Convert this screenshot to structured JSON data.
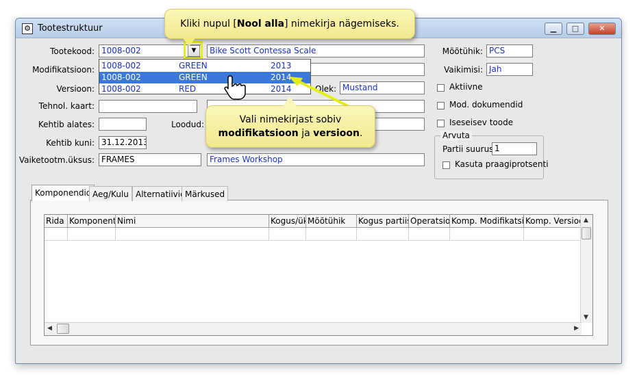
{
  "window": {
    "title": "Tootestruktuur",
    "buttons": {
      "minimize": "▁",
      "maximize": "□",
      "close": "✕"
    }
  },
  "form": {
    "tootekood": {
      "label": "Tootekood:",
      "value": "1008-002",
      "description": "Bike Scott Contessa Scale"
    },
    "modifikatsioon": {
      "label": "Modifikatsioon:"
    },
    "versioon": {
      "label": "Versioon:"
    },
    "tehnol_kaart": {
      "label": "Tehnol. kaart:"
    },
    "kehtib_alates": {
      "label": "Kehtib alates:"
    },
    "loodud": {
      "label": "Loodud:"
    },
    "kehtib_kuni": {
      "label": "Kehtib kuni:",
      "value": "31.12.2013"
    },
    "vaiketootm": {
      "label": "Vaiketootm.üksus:",
      "value": "FRAMES",
      "description": "Frames Workshop"
    },
    "olek": {
      "label": "Olek:",
      "value": "Mustand"
    },
    "mootuhik": {
      "label": "Mõõtühik:",
      "value": "PCS"
    },
    "vaikimisi": {
      "label": "Vaikimisi:",
      "value": "Jah"
    },
    "aktiivne": {
      "label": "Aktiivne",
      "checked": false
    },
    "mod_dokumendid": {
      "label": "Mod. dokumendid",
      "checked": false
    },
    "iseseisev_toode": {
      "label": "Iseseisev toode",
      "checked": false
    },
    "arvuta": {
      "title": "Arvuta",
      "partii_label": "Partii suurus:",
      "partii_value": "1",
      "kasuta_label": "Kasuta praagiprotsenti",
      "kasuta_checked": false
    }
  },
  "dropdown": {
    "rows": [
      {
        "code": "1008-002",
        "mod": "GREEN",
        "version": "2013",
        "selected": false
      },
      {
        "code": "1008-002",
        "mod": "GREEN",
        "version": "2014",
        "selected": true
      },
      {
        "code": "1008-002",
        "mod": "RED",
        "version": "2014",
        "selected": false
      }
    ]
  },
  "tabs": [
    {
      "label": "Komponendid",
      "active": true
    },
    {
      "label": "Aeg/Kulu",
      "active": false
    },
    {
      "label": "Alternatiivid",
      "active": false
    },
    {
      "label": "Märkused",
      "active": false
    }
  ],
  "grid": {
    "columns": [
      "Rida",
      "Komponent",
      "Nimi",
      "Kogus/ük",
      "Mõõtühik",
      "Kogus partiis",
      "Operatsioo",
      "Komp. Modifikatsioo",
      "Komp. Versioo"
    ]
  },
  "callouts": {
    "top": {
      "before": "Kliki nupul [",
      "bold": "Nool alla",
      "after": "] nimekirja nägemiseks."
    },
    "middle": {
      "line1": "Vali nimekirjast sobiv",
      "bold1": "modifikatsioon",
      "mid": " ja ",
      "bold2": "versioon",
      "end": "."
    }
  },
  "colors": {
    "highlight": "#e6ee1a",
    "selected_row": "#3b78d8",
    "link_text": "#1a33c8",
    "callout": "#f1e88e"
  }
}
